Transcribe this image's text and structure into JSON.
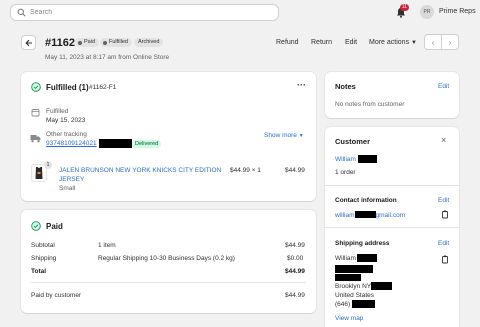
{
  "topbar": {
    "search_placeholder": "Search",
    "notification_count": "11",
    "avatar_initials": "PR",
    "store_name": "Prime Reps"
  },
  "header": {
    "order_id": "#1162",
    "badges": [
      "Paid",
      "Fulfilled",
      "Archived"
    ],
    "subtitle": "May 11, 2023 at 8:17 am from Online Store",
    "actions": {
      "refund": "Refund",
      "return": "Return",
      "edit": "Edit",
      "more": "More actions"
    }
  },
  "fulfilled_card": {
    "title": "Fulfilled (1)",
    "fulfillment_id": "#1162-F1",
    "fulfilled_label": "Fulfilled",
    "fulfilled_date": "May 15, 2023",
    "tracking_label": "Other tracking",
    "tracking_number": "93748109124021",
    "delivered_badge": "Delivered",
    "show_more": "Show more",
    "item": {
      "qty_badge": "1",
      "name_line1": "JALEN BRUNSON NEW YORK KNICKS CITY EDITION",
      "name_line2": "JERSEY",
      "variant": "Small",
      "unit_price": "$44.99 × 1",
      "total": "$44.99"
    }
  },
  "paid_card": {
    "title": "Paid",
    "rows": [
      {
        "label": "Subtotal",
        "desc": "1 item",
        "amount": "$44.99"
      },
      {
        "label": "Shipping",
        "desc": "Regular Shipping 10-30 Business Days (0.2 kg)",
        "amount": "$0.00"
      },
      {
        "label": "Total",
        "desc": "",
        "amount": "$44.99"
      }
    ],
    "paid_by_label": "Paid by customer",
    "paid_by_amount": "$44.99"
  },
  "notes_card": {
    "title": "Notes",
    "edit": "Edit",
    "empty": "No notes from customer"
  },
  "customer_card": {
    "title": "Customer",
    "name": "William",
    "orders": "1 order",
    "contact_title": "Contact information",
    "contact_edit": "Edit",
    "email_prefix": "william",
    "email_suffix": "gmail.com",
    "shipping_title": "Shipping address",
    "shipping_edit": "Edit",
    "address_name": "William",
    "address_city": "Brooklyn NY",
    "address_country": "United States",
    "address_phone": "(646)",
    "view_map": "View map"
  },
  "colors": {
    "link": "#2c6ecb",
    "success": "#29845a",
    "badge_bg": "#e3e3e3",
    "delivered_bg": "#cdfee1"
  }
}
